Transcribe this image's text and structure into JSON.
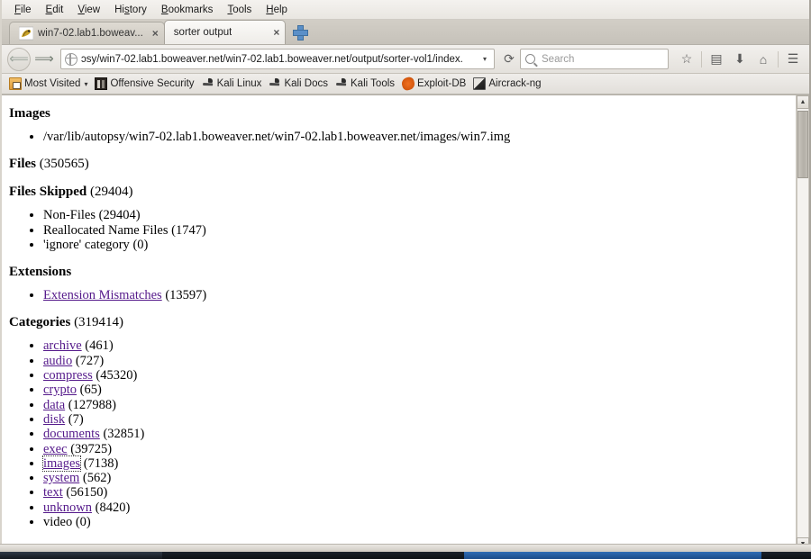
{
  "browser": {
    "menu": [
      {
        "label": "File",
        "accel": "F"
      },
      {
        "label": "Edit",
        "accel": "E"
      },
      {
        "label": "View",
        "accel": "V"
      },
      {
        "label": "History",
        "accel": "s"
      },
      {
        "label": "Bookmarks",
        "accel": "B"
      },
      {
        "label": "Tools",
        "accel": "T"
      },
      {
        "label": "Help",
        "accel": "H"
      }
    ],
    "tabs": [
      {
        "label": "win7-02.lab1.boweav...",
        "active": false,
        "close": "×"
      },
      {
        "label": "sorter output",
        "active": true,
        "close": "×"
      }
    ],
    "new_tab_tooltip": "Open a new tab",
    "url": "ɔsy/win7-02.lab1.boweaver.net/win7-02.lab1.boweaver.net/output/sorter-vol1/index.",
    "url_dropdown": "▾",
    "reload": "⟳",
    "back": "←",
    "forward": "→",
    "search": {
      "placeholder": "Search",
      "value": ""
    },
    "toolbar_icons": [
      {
        "name": "bookmark-star-icon",
        "glyph": "☆"
      },
      {
        "name": "library-icon",
        "glyph": "▤"
      },
      {
        "name": "downloads-icon",
        "glyph": "⬇"
      },
      {
        "name": "home-icon",
        "glyph": "⌂"
      },
      {
        "name": "menu-hamburger-icon",
        "glyph": "☰"
      }
    ],
    "bookmarks": [
      {
        "label": "Most Visited",
        "icon": "ic-mostvisited",
        "caret": "▾"
      },
      {
        "label": "Offensive Security",
        "icon": "ic-offsec",
        "caret": ""
      },
      {
        "label": "Kali Linux",
        "icon": "ic-dragon",
        "caret": ""
      },
      {
        "label": "Kali Docs",
        "icon": "ic-dragon",
        "caret": ""
      },
      {
        "label": "Kali Tools",
        "icon": "ic-dragon",
        "caret": ""
      },
      {
        "label": "Exploit-DB",
        "icon": "ic-exploit",
        "caret": ""
      },
      {
        "label": "Aircrack-ng",
        "icon": "ic-aircrack",
        "caret": ""
      }
    ]
  },
  "page": {
    "sections": {
      "images": {
        "heading": "Images",
        "items": [
          "/var/lib/autopsy/win7-02.lab1.boweaver.net/win7-02.lab1.boweaver.net/images/win7.img"
        ]
      },
      "files": {
        "heading": "Files",
        "count": "(350565)"
      },
      "files_skipped": {
        "heading": "Files Skipped",
        "count": "(29404)",
        "items": [
          {
            "label": "Non-Files",
            "count": "(29404)"
          },
          {
            "label": "Reallocated Name Files",
            "count": "(1747)"
          },
          {
            "label": "'ignore' category",
            "count": "(0)"
          }
        ]
      },
      "extensions": {
        "heading": "Extensions",
        "items": [
          {
            "label": "Extension Mismatches",
            "count": "(13597)",
            "link": true,
            "focused": false
          }
        ]
      },
      "categories": {
        "heading": "Categories",
        "count": "(319414)",
        "items": [
          {
            "label": "archive",
            "count": "(461)",
            "link": true,
            "focused": false
          },
          {
            "label": "audio",
            "count": "(727)",
            "link": true,
            "focused": false
          },
          {
            "label": "compress",
            "count": "(45320)",
            "link": true,
            "focused": false
          },
          {
            "label": "crypto",
            "count": "(65)",
            "link": true,
            "focused": false
          },
          {
            "label": "data",
            "count": "(127988)",
            "link": true,
            "focused": false
          },
          {
            "label": "disk",
            "count": "(7)",
            "link": true,
            "focused": false
          },
          {
            "label": "documents",
            "count": "(32851)",
            "link": true,
            "focused": false
          },
          {
            "label": "exec",
            "count": "(39725)",
            "link": true,
            "focused": false
          },
          {
            "label": "images",
            "count": "(7138)",
            "link": true,
            "focused": true
          },
          {
            "label": "system",
            "count": "(562)",
            "link": true,
            "focused": false
          },
          {
            "label": "text",
            "count": "(56150)",
            "link": true,
            "focused": false
          },
          {
            "label": "unknown",
            "count": "(8420)",
            "link": true,
            "focused": false
          },
          {
            "label": "video",
            "count": "(0)",
            "link": false,
            "focused": false
          }
        ]
      }
    }
  },
  "scrollbar": {
    "up_arrow": "▲",
    "down_arrow": "▼"
  },
  "colors": {
    "link": "#551a8b",
    "page_bg": "#ffffff",
    "chrome_bg": "#e9e6e1",
    "taskbar_active": "#2f6db5"
  }
}
